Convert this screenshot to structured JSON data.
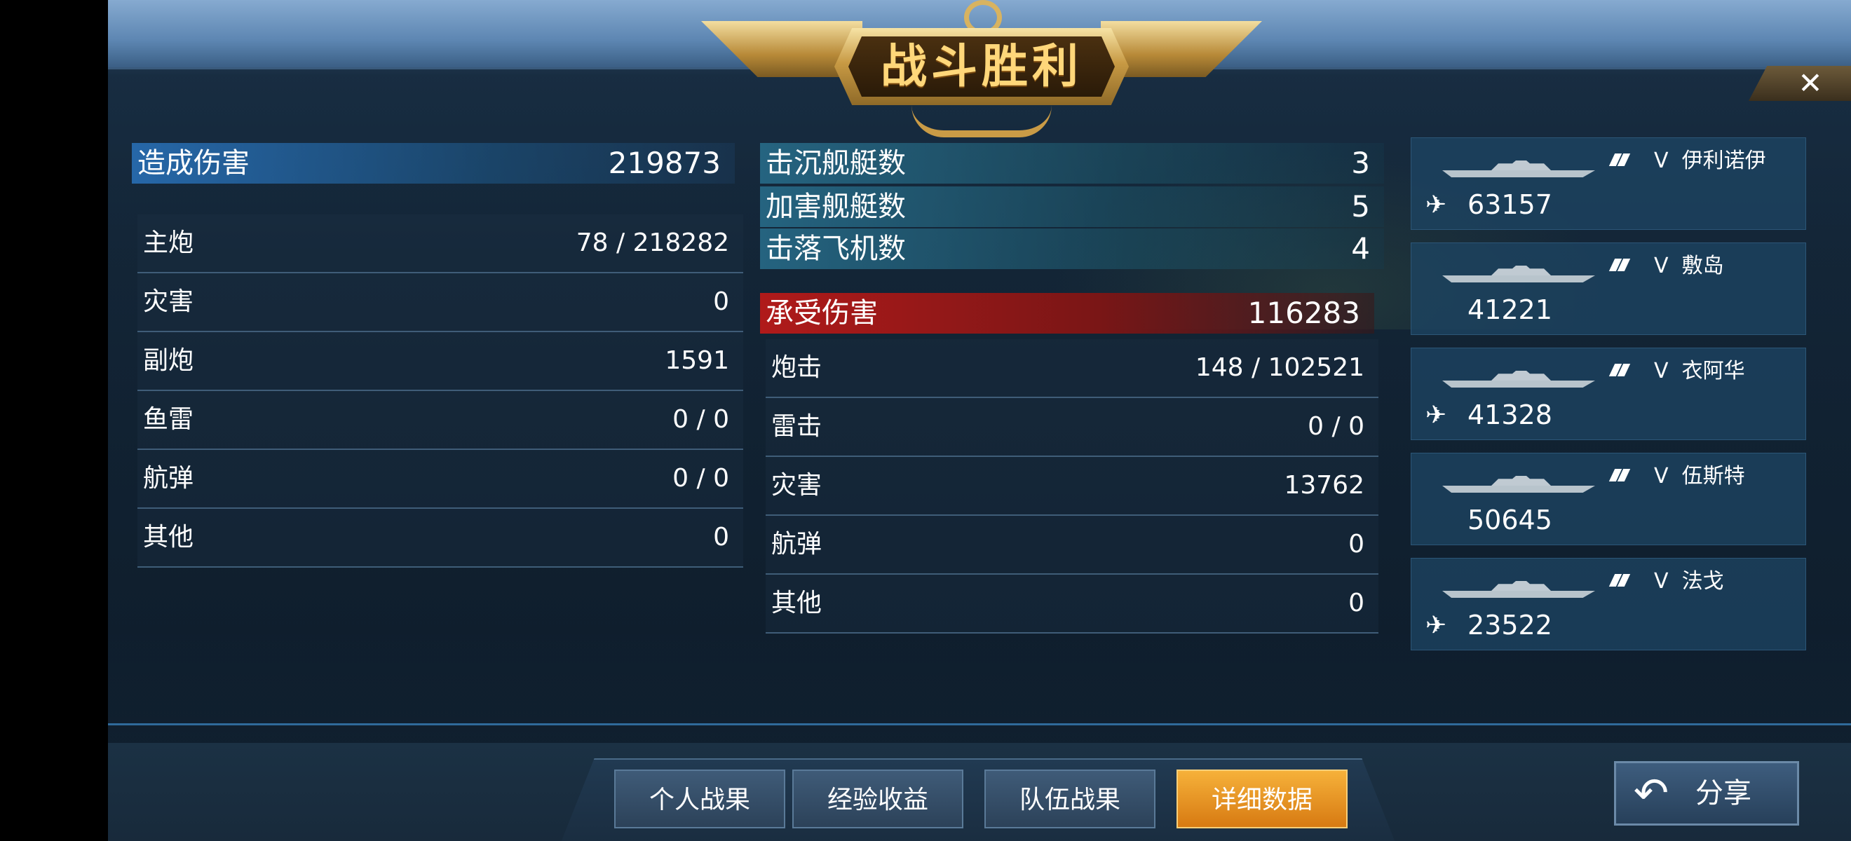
{
  "title": "战斗胜利",
  "close_icon": "close-icon",
  "damage_dealt": {
    "label": "造成伤害",
    "value": "219873",
    "rows": [
      {
        "label": "主炮",
        "value": "78 / 218282"
      },
      {
        "label": "灾害",
        "value": "0"
      },
      {
        "label": "副炮",
        "value": "1591"
      },
      {
        "label": "鱼雷",
        "value": "0 / 0"
      },
      {
        "label": "航弹",
        "value": "0 / 0"
      },
      {
        "label": "其他",
        "value": "0"
      }
    ]
  },
  "kill_stats": [
    {
      "label": "击沉舰艇数",
      "value": "3"
    },
    {
      "label": "加害舰艇数",
      "value": "5"
    },
    {
      "label": "击落飞机数",
      "value": "4"
    }
  ],
  "damage_taken": {
    "label": "承受伤害",
    "value": "116283",
    "rows": [
      {
        "label": "炮击",
        "value": "148 / 102521"
      },
      {
        "label": "雷击",
        "value": "0 / 0"
      },
      {
        "label": "灾害",
        "value": "13762"
      },
      {
        "label": "航弹",
        "value": "0"
      },
      {
        "label": "其他",
        "value": "0"
      }
    ]
  },
  "ships": [
    {
      "tier": "V",
      "name": "伊利诺伊",
      "score": "63157",
      "has_plane": true
    },
    {
      "tier": "V",
      "name": "敷岛",
      "score": "41221",
      "has_plane": false
    },
    {
      "tier": "V",
      "name": "衣阿华",
      "score": "41328",
      "has_plane": true
    },
    {
      "tier": "V",
      "name": "伍斯特",
      "score": "50645",
      "has_plane": false
    },
    {
      "tier": "V",
      "name": "法戈",
      "score": "23522",
      "has_plane": true
    }
  ],
  "tabs": [
    {
      "label": "个人战果",
      "active": false
    },
    {
      "label": "经验收益",
      "active": false
    },
    {
      "label": "队伍战果",
      "active": false
    },
    {
      "label": "详细数据",
      "active": true
    }
  ],
  "share": {
    "label": "分享",
    "icon": "share-arrow-icon"
  },
  "colors": {
    "accent_gold": "#ffd77a",
    "active_tab": "#f6b13a",
    "damage_taken_red": "#b01a1a",
    "damage_dealt_blue": "#286eb4"
  }
}
